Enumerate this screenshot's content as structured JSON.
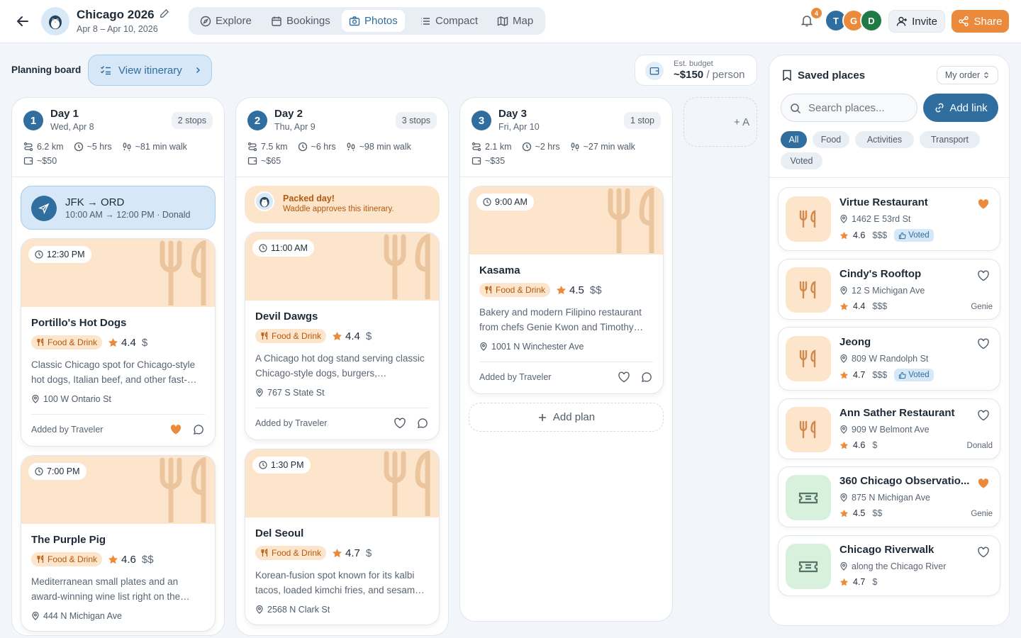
{
  "header": {
    "trip_title": "Chicago 2026",
    "trip_dates": "Apr 8 – Apr 10, 2026",
    "nav": [
      {
        "label": "Explore",
        "icon": "compass-icon"
      },
      {
        "label": "Bookings",
        "icon": "calendar-icon"
      },
      {
        "label": "Photos",
        "icon": "camera-icon",
        "active": true
      },
      {
        "label": "Compact",
        "icon": "list-icon"
      },
      {
        "label": "Map",
        "icon": "map-icon"
      }
    ],
    "notification_count": "4",
    "members": [
      {
        "initial": "T",
        "color": "#2f6e9e"
      },
      {
        "initial": "G",
        "color": "#ec8a3c"
      },
      {
        "initial": "D",
        "color": "#1f7a45"
      }
    ],
    "invite_label": "Invite",
    "share_label": "Share"
  },
  "planning": {
    "label": "Planning board",
    "itinerary_label": "View itinerary",
    "budget_label": "Est. budget",
    "budget_value": "~$150",
    "budget_unit": "/ person"
  },
  "days": [
    {
      "num": "1",
      "title": "Day 1",
      "date": "Wed, Apr 8",
      "stops": "2 stops",
      "distance": "6.2 km",
      "duration": "~5 hrs",
      "walk": "~81 min walk",
      "cost": "~$50",
      "flight": {
        "route": "JFK → ORD",
        "meta": "10:00 AM → 12:00 PM · Donald"
      },
      "plans": [
        {
          "time": "12:30 PM",
          "name": "Portillo's Hot Dogs",
          "category": "Food & Drink",
          "rating": "4.4",
          "price": "$",
          "desc": "Classic Chicago spot for Chicago-style hot dogs, Italian beef, and other fast-…",
          "address": "100 W Ontario St",
          "added_by": "Added by Traveler",
          "liked": true
        },
        {
          "time": "7:00 PM",
          "name": "The Purple Pig",
          "category": "Food & Drink",
          "rating": "4.6",
          "price": "$$",
          "desc": "Mediterranean small plates and an award-winning wine list right on the…",
          "address": "444 N Michigan Ave",
          "added_by": "",
          "liked": false
        }
      ]
    },
    {
      "num": "2",
      "title": "Day 2",
      "date": "Thu, Apr 9",
      "stops": "3 stops",
      "distance": "7.5 km",
      "duration": "~6 hrs",
      "walk": "~98 min walk",
      "cost": "~$65",
      "packed": {
        "title": "Packed day!",
        "subtitle": "Waddle approves this itinerary."
      },
      "plans": [
        {
          "time": "11:00 AM",
          "name": "Devil Dawgs",
          "category": "Food & Drink",
          "rating": "4.4",
          "price": "$",
          "desc": "A Chicago hot dog stand serving classic Chicago-style dogs, burgers,…",
          "address": "767 S State St",
          "added_by": "Added by Traveler",
          "liked": false
        },
        {
          "time": "1:30 PM",
          "name": "Del Seoul",
          "category": "Food & Drink",
          "rating": "4.7",
          "price": "$",
          "desc": "Korean-fusion spot known for its kalbi tacos, loaded kimchi fries, and sesam…",
          "address": "2568 N Clark St",
          "added_by": "",
          "liked": false
        }
      ]
    },
    {
      "num": "3",
      "title": "Day 3",
      "date": "Fri, Apr 10",
      "stops": "1 stop",
      "distance": "2.1 km",
      "duration": "~2 hrs",
      "walk": "~27 min walk",
      "cost": "~$35",
      "plans": [
        {
          "time": "9:00 AM",
          "name": "Kasama",
          "category": "Food & Drink",
          "rating": "4.5",
          "price": "$$",
          "desc": "Bakery and modern Filipino restaurant from chefs Genie Kwon and Timothy…",
          "address": "1001 N Winchester Ave",
          "added_by": "Added by Traveler",
          "liked": false
        }
      ],
      "add_plan_label": "Add plan"
    }
  ],
  "add_day_label": "+ A",
  "saved": {
    "title": "Saved places",
    "order_label": "My order",
    "search_placeholder": "Search places...",
    "add_link_label": "Add link",
    "filters": [
      "All",
      "Food",
      "Activities",
      "Transport",
      "Voted"
    ],
    "places": [
      {
        "name": "Virtue Restaurant",
        "address": "1462 E 53rd St",
        "rating": "4.6",
        "price": "$$$",
        "voted": "Voted",
        "by": "",
        "liked": true,
        "kind": "food"
      },
      {
        "name": "Cindy's Rooftop",
        "address": "12 S Michigan Ave",
        "rating": "4.4",
        "price": "$$$",
        "voted": "",
        "by": "Genie",
        "liked": false,
        "kind": "food"
      },
      {
        "name": "Jeong",
        "address": "809 W Randolph St",
        "rating": "4.7",
        "price": "$$$",
        "voted": "Voted",
        "by": "",
        "liked": false,
        "kind": "food"
      },
      {
        "name": "Ann Sather Restaurant",
        "address": "909 W Belmont Ave",
        "rating": "4.6",
        "price": "$",
        "voted": "",
        "by": "Donald",
        "liked": false,
        "kind": "food"
      },
      {
        "name": "360 Chicago Observatio...",
        "address": "875 N Michigan Ave",
        "rating": "4.5",
        "price": "$$",
        "voted": "",
        "by": "Genie",
        "liked": true,
        "kind": "activity"
      },
      {
        "name": "Chicago Riverwalk",
        "address": "along the Chicago River",
        "rating": "4.7",
        "price": "$",
        "voted": "",
        "by": "",
        "liked": false,
        "kind": "activity"
      }
    ]
  }
}
